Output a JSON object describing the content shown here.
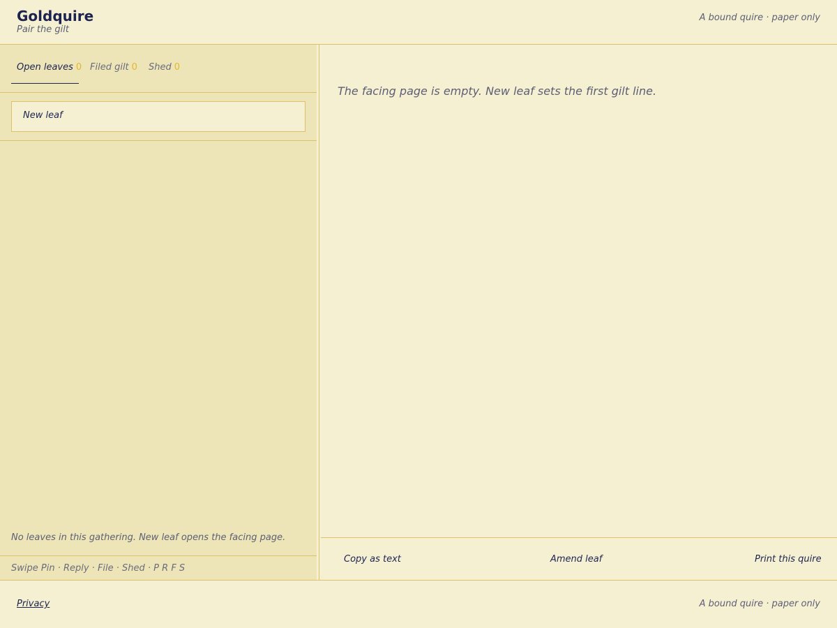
{
  "header": {
    "title": "Goldquire",
    "subtitle": "Pair the gilt",
    "tagline": "A bound quire · paper only"
  },
  "sidebar": {
    "tabs": [
      {
        "label": "Open leaves",
        "count": "0"
      },
      {
        "label": "Filed gilt",
        "count": "0"
      },
      {
        "label": "Shed",
        "count": "0"
      }
    ],
    "new_leaf_label": "New leaf",
    "empty_note": "No leaves in this gathering. New leaf opens the facing page.",
    "shortcuts": "Swipe Pin · Reply · File · Shed · P R F S"
  },
  "main": {
    "empty_message": "The facing page is empty. New leaf sets the first gilt line.",
    "actions": {
      "copy": "Copy as text",
      "amend": "Amend leaf",
      "print": "Print this quire"
    }
  },
  "footer": {
    "privacy": "Privacy",
    "tagline": "A bound quire · paper only"
  },
  "colors": {
    "background": "#f6f0d3",
    "sidebar": "#ede5b8",
    "rule": "#dcc168",
    "ink": "#1c2350",
    "count_accent": "#e2b82c"
  }
}
